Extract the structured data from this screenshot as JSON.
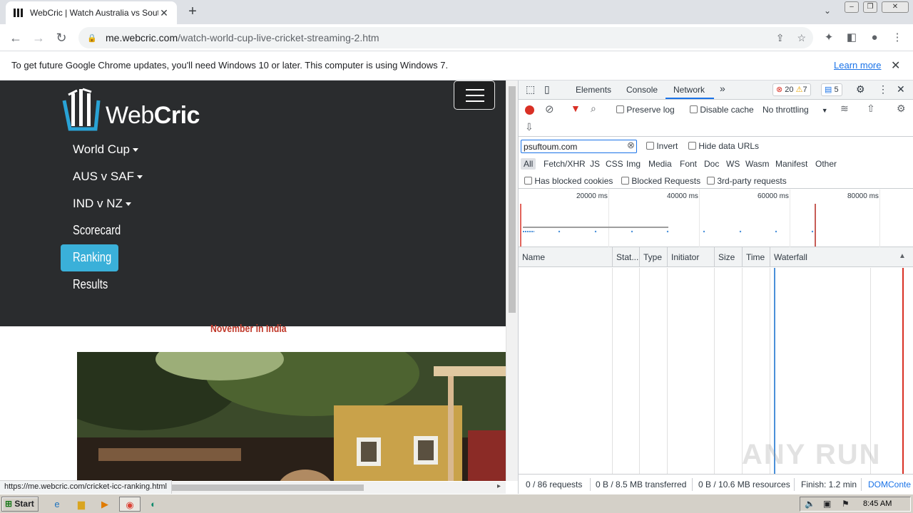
{
  "tab": {
    "title": "WebCric | Watch Australia vs South",
    "close": "✕"
  },
  "newtab": "+",
  "toolbar": {
    "url_host": "me.webcric.com",
    "url_path": "/watch-world-cup-live-cricket-streaming-2.htm"
  },
  "infobar": {
    "message": "To get future Google Chrome updates, you'll need Windows 10 or later. This computer is using Windows 7.",
    "learn_more": "Learn more"
  },
  "site": {
    "logo": {
      "prefix": "Web",
      "suffix": "Cric"
    },
    "nav": [
      {
        "label": "World Cup",
        "dropdown": true
      },
      {
        "label": "AUS v SAF",
        "dropdown": true
      },
      {
        "label": "IND v NZ",
        "dropdown": true
      },
      {
        "label": "Scorecard",
        "dropdown": false
      },
      {
        "label": "Ranking",
        "dropdown": false,
        "active": true
      },
      {
        "label": "Results",
        "dropdown": false
      }
    ],
    "headline": "November in India",
    "status_url": "https://me.webcric.com/cricket-icc-ranking.html"
  },
  "devtools": {
    "tabs": [
      "Elements",
      "Console",
      "Network"
    ],
    "active_tab": "Network",
    "more": "»",
    "errors": "20",
    "warnings": "7",
    "messages": "5",
    "preserve_log": "Preserve log",
    "disable_cache": "Disable cache",
    "throttling": "No throttling",
    "filter_value": "psuftoum.com",
    "invert": "Invert",
    "hide_data_urls": "Hide data URLs",
    "types": [
      "All",
      "Fetch/XHR",
      "JS",
      "CSS",
      "Img",
      "Media",
      "Font",
      "Doc",
      "WS",
      "Wasm",
      "Manifest",
      "Other"
    ],
    "has_blocked_cookies": "Has blocked cookies",
    "blocked_requests": "Blocked Requests",
    "third_party": "3rd-party requests",
    "timeline_ticks": [
      "20000 ms",
      "40000 ms",
      "60000 ms",
      "80000 ms"
    ],
    "columns": [
      "Name",
      "Stat...",
      "Type",
      "Initiator",
      "Size",
      "Time",
      "Waterfall"
    ],
    "status": {
      "requests": "0 / 86 requests",
      "transferred": "0 B / 8.5 MB transferred",
      "resources": "0 B / 10.6 MB resources",
      "finish": "Finish: 1.2 min",
      "domcontent": "DOMConte"
    },
    "watermark": "ANY RUN"
  },
  "taskbar": {
    "start": "Start",
    "clock": "8:45 AM"
  },
  "colors": {
    "accent_blue": "#1a73e8",
    "nav_bg": "#2a2c2e",
    "ranking_bg": "#3ab0d9",
    "headline": "#c0392b",
    "record_red": "#d93025"
  }
}
